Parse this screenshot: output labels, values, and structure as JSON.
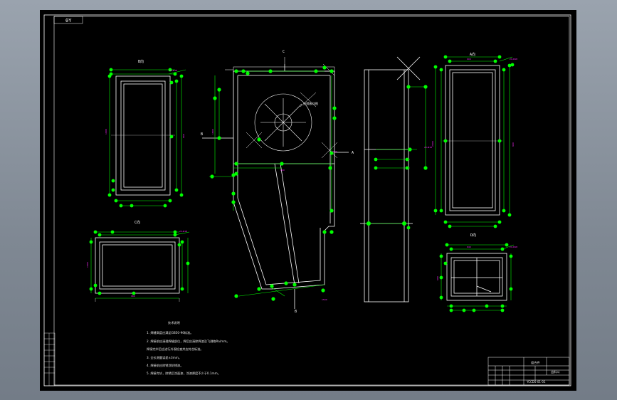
{
  "drawing": {
    "corner_code": "0Y",
    "views": {
      "b": "B向",
      "a": "A向",
      "c_top": "C",
      "c_left": "C向",
      "d": "D向",
      "section_b": "B",
      "section_a": "A",
      "bottom_mark": "B"
    },
    "circle_note": "分隔板详图",
    "notes": {
      "title": "技术说明",
      "lines": [
        "1. 焊缝高度应满足GB50-96标准。",
        "2. 焊接前应清理焊缝部位，焊后应清除焊渣及飞溅物Ra/mm。",
        "   焊接完毕后应进行外观检查并应符合标准。",
        "3. 全长测量误差±3mm。",
        "4. 焊接前应除锈涂防锈漆。",
        "5. 焊接完毕，除锈后涂面漆，涂漆厚度不少于0.1mm。"
      ]
    },
    "title_block": {
      "name": "出料斗",
      "material": "组合件",
      "drawing_no": "YCCDS-01-01"
    }
  },
  "colors": {
    "background": "#000000",
    "frame": "#ffffff",
    "dimension": "#00ff00",
    "text_dim": "#ff2bff",
    "line": "#ffffff"
  }
}
